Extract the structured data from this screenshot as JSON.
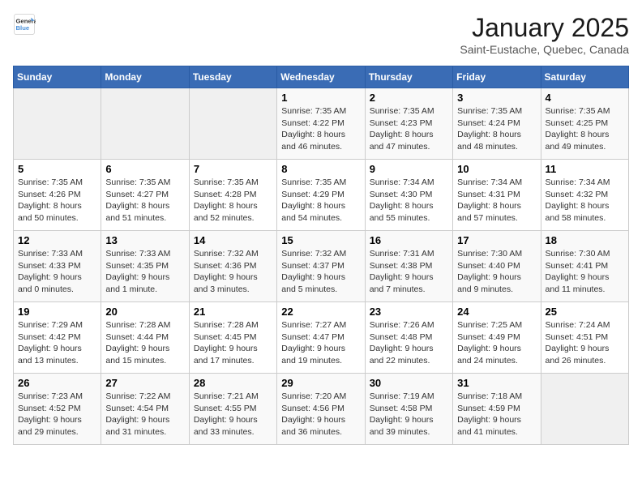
{
  "header": {
    "logo_line1": "General",
    "logo_line2": "Blue",
    "title": "January 2025",
    "subtitle": "Saint-Eustache, Quebec, Canada"
  },
  "weekdays": [
    "Sunday",
    "Monday",
    "Tuesday",
    "Wednesday",
    "Thursday",
    "Friday",
    "Saturday"
  ],
  "weeks": [
    [
      {
        "day": "",
        "info": ""
      },
      {
        "day": "",
        "info": ""
      },
      {
        "day": "",
        "info": ""
      },
      {
        "day": "1",
        "info": "Sunrise: 7:35 AM\nSunset: 4:22 PM\nDaylight: 8 hours and 46 minutes."
      },
      {
        "day": "2",
        "info": "Sunrise: 7:35 AM\nSunset: 4:23 PM\nDaylight: 8 hours and 47 minutes."
      },
      {
        "day": "3",
        "info": "Sunrise: 7:35 AM\nSunset: 4:24 PM\nDaylight: 8 hours and 48 minutes."
      },
      {
        "day": "4",
        "info": "Sunrise: 7:35 AM\nSunset: 4:25 PM\nDaylight: 8 hours and 49 minutes."
      }
    ],
    [
      {
        "day": "5",
        "info": "Sunrise: 7:35 AM\nSunset: 4:26 PM\nDaylight: 8 hours and 50 minutes."
      },
      {
        "day": "6",
        "info": "Sunrise: 7:35 AM\nSunset: 4:27 PM\nDaylight: 8 hours and 51 minutes."
      },
      {
        "day": "7",
        "info": "Sunrise: 7:35 AM\nSunset: 4:28 PM\nDaylight: 8 hours and 52 minutes."
      },
      {
        "day": "8",
        "info": "Sunrise: 7:35 AM\nSunset: 4:29 PM\nDaylight: 8 hours and 54 minutes."
      },
      {
        "day": "9",
        "info": "Sunrise: 7:34 AM\nSunset: 4:30 PM\nDaylight: 8 hours and 55 minutes."
      },
      {
        "day": "10",
        "info": "Sunrise: 7:34 AM\nSunset: 4:31 PM\nDaylight: 8 hours and 57 minutes."
      },
      {
        "day": "11",
        "info": "Sunrise: 7:34 AM\nSunset: 4:32 PM\nDaylight: 8 hours and 58 minutes."
      }
    ],
    [
      {
        "day": "12",
        "info": "Sunrise: 7:33 AM\nSunset: 4:33 PM\nDaylight: 9 hours and 0 minutes."
      },
      {
        "day": "13",
        "info": "Sunrise: 7:33 AM\nSunset: 4:35 PM\nDaylight: 9 hours and 1 minute."
      },
      {
        "day": "14",
        "info": "Sunrise: 7:32 AM\nSunset: 4:36 PM\nDaylight: 9 hours and 3 minutes."
      },
      {
        "day": "15",
        "info": "Sunrise: 7:32 AM\nSunset: 4:37 PM\nDaylight: 9 hours and 5 minutes."
      },
      {
        "day": "16",
        "info": "Sunrise: 7:31 AM\nSunset: 4:38 PM\nDaylight: 9 hours and 7 minutes."
      },
      {
        "day": "17",
        "info": "Sunrise: 7:30 AM\nSunset: 4:40 PM\nDaylight: 9 hours and 9 minutes."
      },
      {
        "day": "18",
        "info": "Sunrise: 7:30 AM\nSunset: 4:41 PM\nDaylight: 9 hours and 11 minutes."
      }
    ],
    [
      {
        "day": "19",
        "info": "Sunrise: 7:29 AM\nSunset: 4:42 PM\nDaylight: 9 hours and 13 minutes."
      },
      {
        "day": "20",
        "info": "Sunrise: 7:28 AM\nSunset: 4:44 PM\nDaylight: 9 hours and 15 minutes."
      },
      {
        "day": "21",
        "info": "Sunrise: 7:28 AM\nSunset: 4:45 PM\nDaylight: 9 hours and 17 minutes."
      },
      {
        "day": "22",
        "info": "Sunrise: 7:27 AM\nSunset: 4:47 PM\nDaylight: 9 hours and 19 minutes."
      },
      {
        "day": "23",
        "info": "Sunrise: 7:26 AM\nSunset: 4:48 PM\nDaylight: 9 hours and 22 minutes."
      },
      {
        "day": "24",
        "info": "Sunrise: 7:25 AM\nSunset: 4:49 PM\nDaylight: 9 hours and 24 minutes."
      },
      {
        "day": "25",
        "info": "Sunrise: 7:24 AM\nSunset: 4:51 PM\nDaylight: 9 hours and 26 minutes."
      }
    ],
    [
      {
        "day": "26",
        "info": "Sunrise: 7:23 AM\nSunset: 4:52 PM\nDaylight: 9 hours and 29 minutes."
      },
      {
        "day": "27",
        "info": "Sunrise: 7:22 AM\nSunset: 4:54 PM\nDaylight: 9 hours and 31 minutes."
      },
      {
        "day": "28",
        "info": "Sunrise: 7:21 AM\nSunset: 4:55 PM\nDaylight: 9 hours and 33 minutes."
      },
      {
        "day": "29",
        "info": "Sunrise: 7:20 AM\nSunset: 4:56 PM\nDaylight: 9 hours and 36 minutes."
      },
      {
        "day": "30",
        "info": "Sunrise: 7:19 AM\nSunset: 4:58 PM\nDaylight: 9 hours and 39 minutes."
      },
      {
        "day": "31",
        "info": "Sunrise: 7:18 AM\nSunset: 4:59 PM\nDaylight: 9 hours and 41 minutes."
      },
      {
        "day": "",
        "info": ""
      }
    ]
  ]
}
